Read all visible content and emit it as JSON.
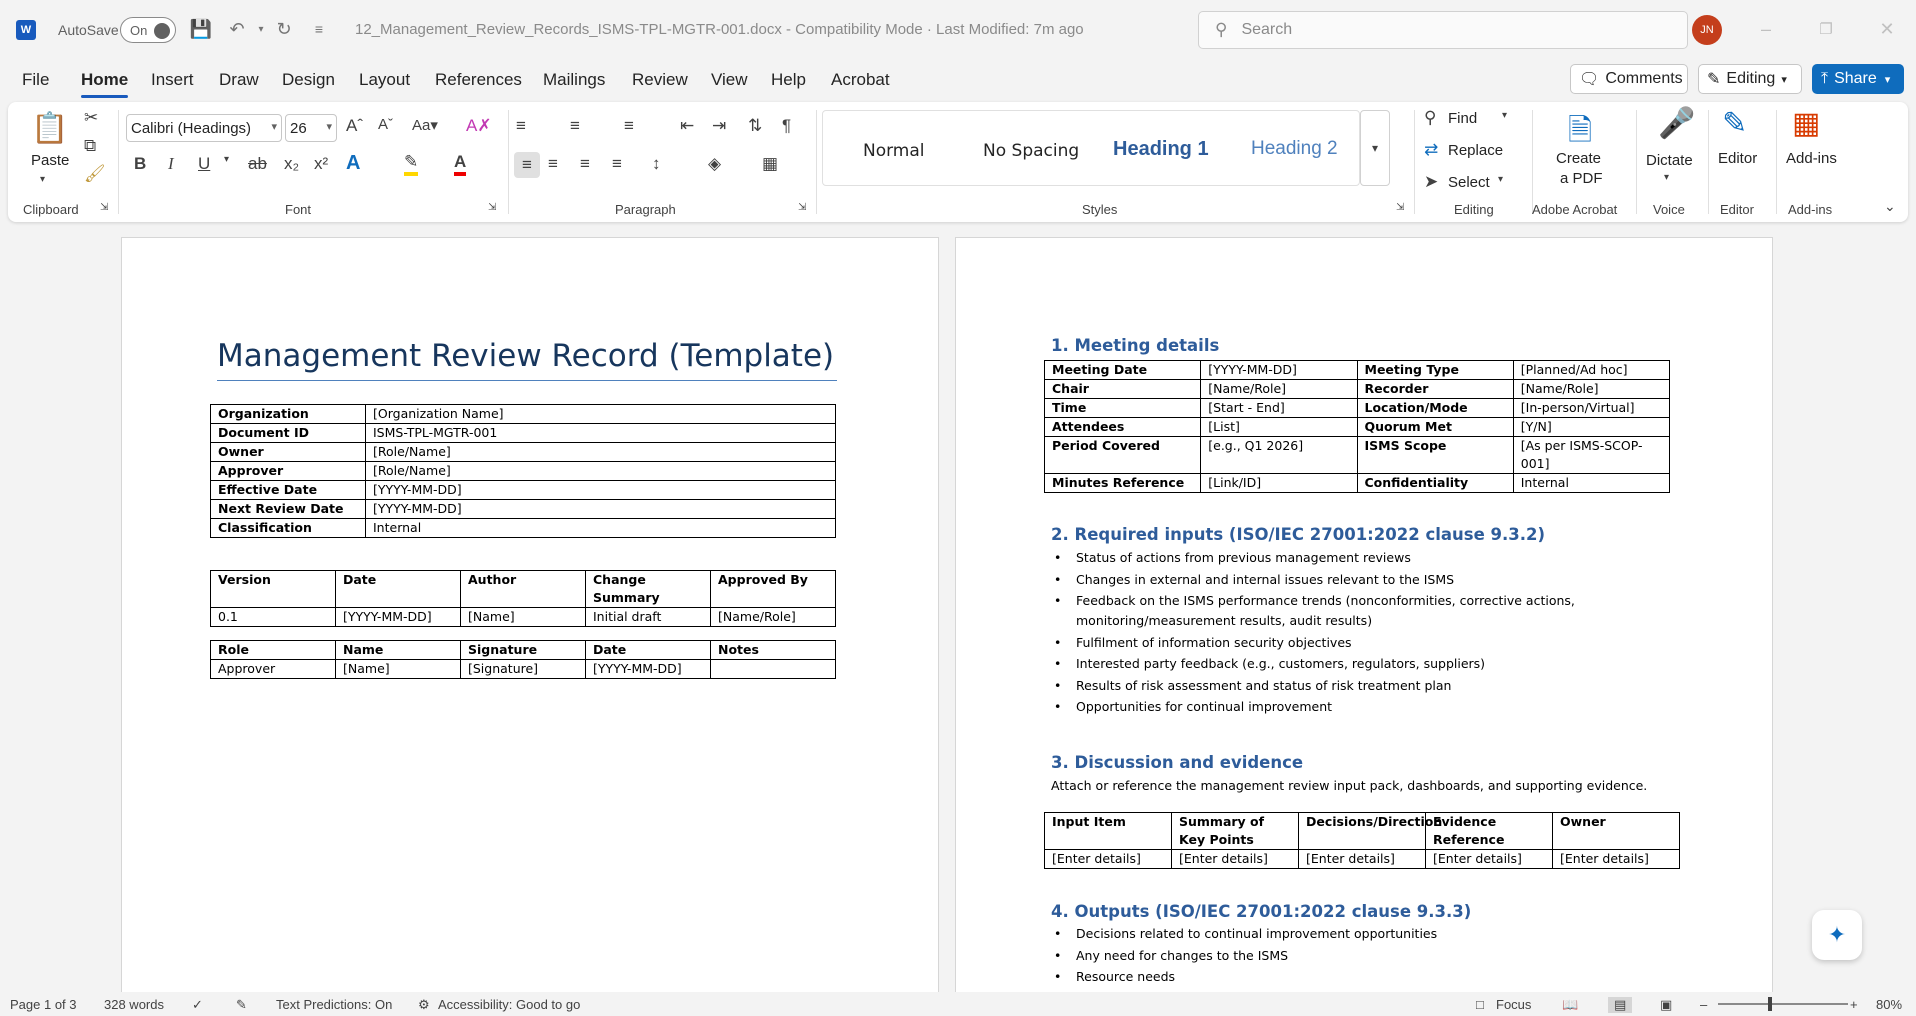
{
  "titlebar": {
    "app_badge": "W",
    "autosave_label": "AutoSave",
    "autosave_state": "On",
    "document_title": "12_Management_Review_Records_ISMS-TPL-MGTR-001.docx  -  Compatibility Mode  ·  Last Modified: 7m ago",
    "search_placeholder": "Search",
    "user_initials": "JN"
  },
  "menu": {
    "items": [
      "File",
      "Home",
      "Insert",
      "Draw",
      "Design",
      "Layout",
      "References",
      "Mailings",
      "Review",
      "View",
      "Help",
      "Acrobat"
    ],
    "active": "Home",
    "comments": "Comments",
    "editing": "Editing",
    "share": "Share"
  },
  "ribbon": {
    "clipboard": {
      "paste": "Paste",
      "label": "Clipboard"
    },
    "font": {
      "name": "Calibri (Headings)",
      "size": "26",
      "label": "Font"
    },
    "paragraph": {
      "label": "Paragraph"
    },
    "styles": {
      "items": [
        "Normal",
        "No Spacing",
        "Heading 1",
        "Heading 2"
      ],
      "label": "Styles"
    },
    "editing": {
      "find": "Find",
      "replace": "Replace",
      "select": "Select",
      "label": "Editing"
    },
    "acrobat": {
      "create_pdf_line1": "Create",
      "create_pdf_line2": "a PDF",
      "label": "Adobe Acrobat"
    },
    "voice": {
      "dictate": "Dictate",
      "label": "Voice"
    },
    "editor": {
      "editor": "Editor",
      "label": "Editor"
    },
    "addins": {
      "addins": "Add-ins",
      "label": "Add-ins"
    }
  },
  "page1": {
    "title": "Management Review Record (Template)",
    "info_table": [
      [
        "Organization",
        "[Organization Name]"
      ],
      [
        "Document ID",
        "ISMS-TPL-MGTR-001"
      ],
      [
        "Owner",
        "[Role/Name]"
      ],
      [
        "Approver",
        "[Role/Name]"
      ],
      [
        "Effective Date",
        "[YYYY-MM-DD]"
      ],
      [
        "Next Review Date",
        "[YYYY-MM-DD]"
      ],
      [
        "Classification",
        "Internal"
      ]
    ],
    "version_table": {
      "headers": [
        "Version",
        "Date",
        "Author",
        "Change Summary",
        "Approved By"
      ],
      "row": [
        "0.1",
        "[YYYY-MM-DD]",
        "[Name]",
        "Initial draft",
        "[Name/Role]"
      ]
    },
    "approval_table": {
      "headers": [
        "Role",
        "Name",
        "Signature",
        "Date",
        "Notes"
      ],
      "row": [
        "Approver",
        "[Name]",
        "[Signature]",
        "[YYYY-MM-DD]",
        ""
      ]
    }
  },
  "page2": {
    "s1_title": "1. Meeting details",
    "meeting_table": [
      [
        "Meeting Date",
        "[YYYY-MM-DD]",
        "Meeting Type",
        "[Planned/Ad hoc]"
      ],
      [
        "Chair",
        "[Name/Role]",
        "Recorder",
        "[Name/Role]"
      ],
      [
        "Time",
        "[Start - End]",
        "Location/Mode",
        "[In-person/Virtual]"
      ],
      [
        "Attendees",
        "[List]",
        "Quorum Met",
        "[Y/N]"
      ],
      [
        "Period Covered",
        "[e.g., Q1 2026]",
        "ISMS Scope",
        "[As per ISMS-SCOP-001]"
      ],
      [
        "Minutes Reference",
        "[Link/ID]",
        "Confidentiality",
        "Internal"
      ]
    ],
    "s2_title": "2. Required inputs (ISO/IEC 27001:2022 clause 9.3.2)",
    "s2_items": [
      "Status of actions from previous management reviews",
      "Changes in external and internal issues relevant to the ISMS",
      "Feedback on the ISMS performance trends (nonconformities, corrective actions, monitoring/measurement results, audit results)",
      "Fulfilment of information security objectives",
      "Interested party feedback (e.g., customers, regulators, suppliers)",
      "Results of risk assessment and status of risk treatment plan",
      "Opportunities for continual improvement"
    ],
    "s3_title": "3. Discussion and evidence",
    "s3_text": "Attach or reference the management review input pack, dashboards, and supporting evidence.",
    "evidence_table": {
      "headers": [
        "Input Item",
        "Summary of Key Points",
        "Decisions/Direction",
        "Evidence Reference",
        "Owner"
      ],
      "row": [
        "[Enter details]",
        "[Enter details]",
        "[Enter details]",
        "[Enter details]",
        "[Enter details]"
      ]
    },
    "s4_title": "4. Outputs (ISO/IEC 27001:2022 clause 9.3.3)",
    "s4_items": [
      "Decisions related to continual improvement opportunities",
      "Any need for changes to the ISMS",
      "Resource needs"
    ]
  },
  "status": {
    "page": "Page 1 of 3",
    "words": "328 words",
    "text_predictions": "Text Predictions: On",
    "accessibility": "Accessibility: Good to go",
    "focus": "Focus",
    "zoom": "80%"
  }
}
